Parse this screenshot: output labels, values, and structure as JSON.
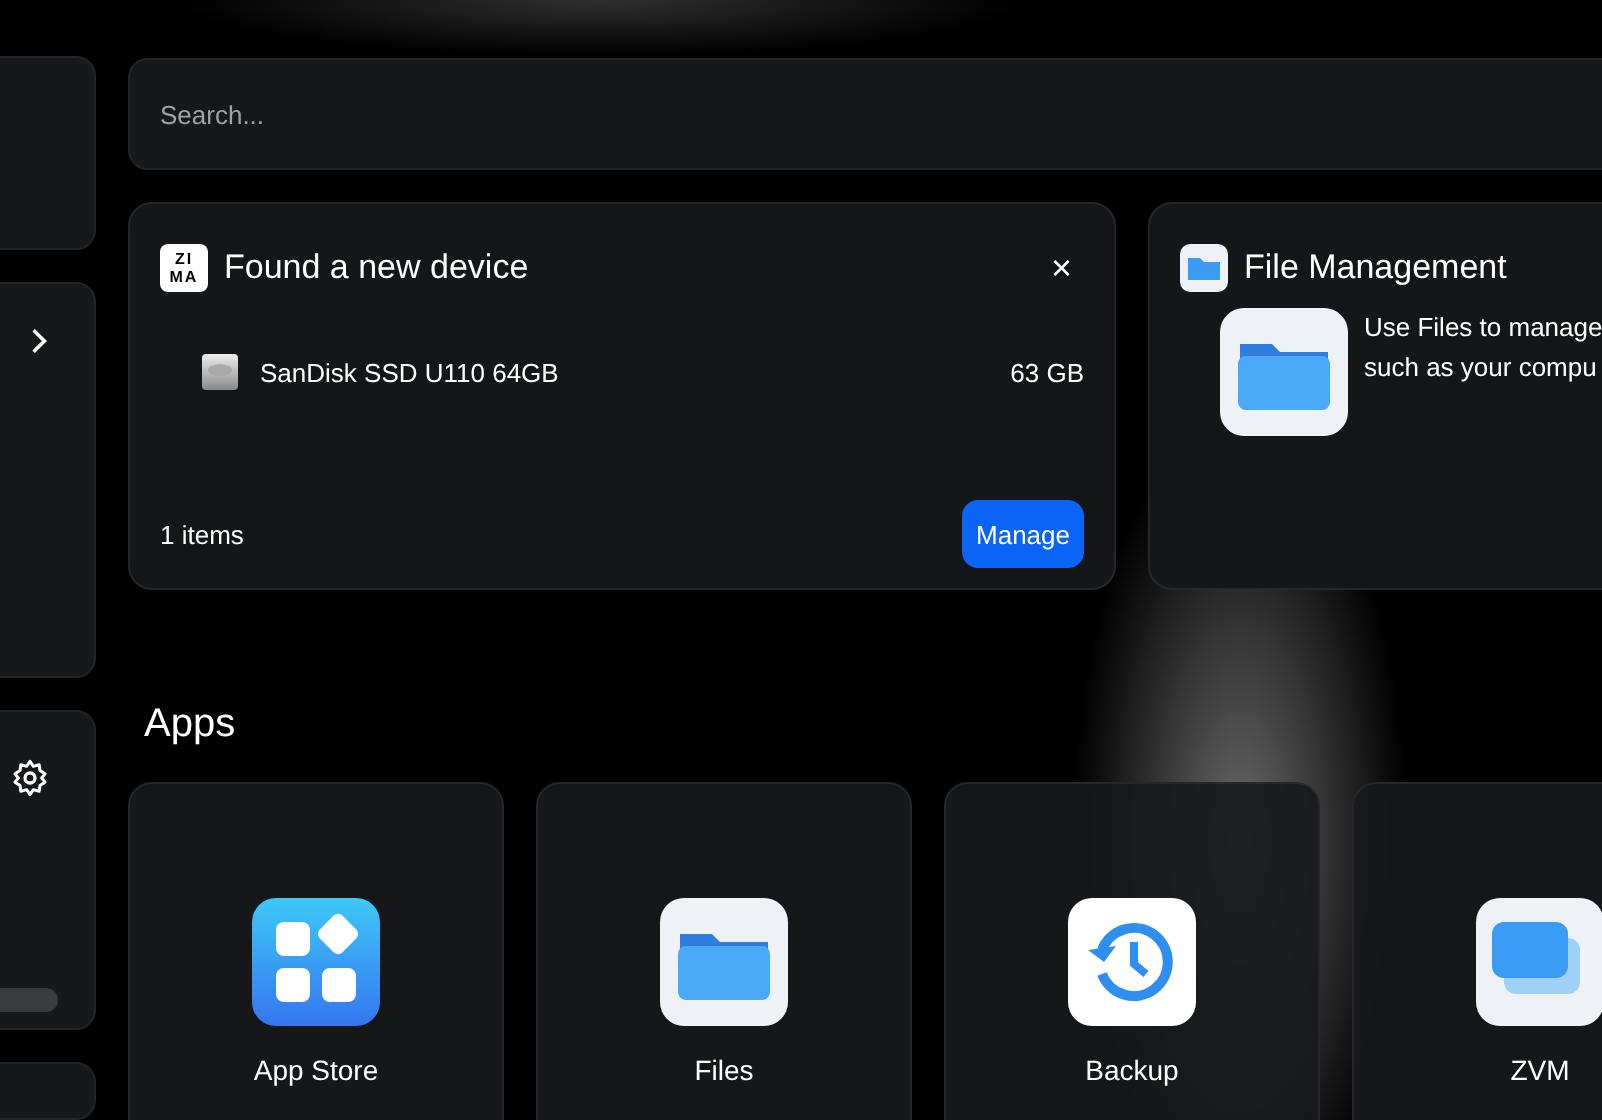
{
  "search": {
    "placeholder": "Search..."
  },
  "device_card": {
    "logo": [
      "ZI",
      "MA"
    ],
    "title": "Found a new device",
    "close": "×",
    "devices": [
      {
        "name": "SanDisk SSD U110 64GB",
        "size": "63 GB"
      }
    ],
    "count": "1 items",
    "button": "Manage"
  },
  "file_card": {
    "title": "File Management",
    "lines": [
      "Use Files to manage",
      "such as your compu"
    ]
  },
  "apps": {
    "heading": "Apps",
    "items": [
      {
        "name": "App Store",
        "kind": "store"
      },
      {
        "name": "Files",
        "kind": "files"
      },
      {
        "name": "Backup",
        "kind": "backup"
      },
      {
        "name": "ZVM",
        "kind": "zvm"
      }
    ]
  }
}
